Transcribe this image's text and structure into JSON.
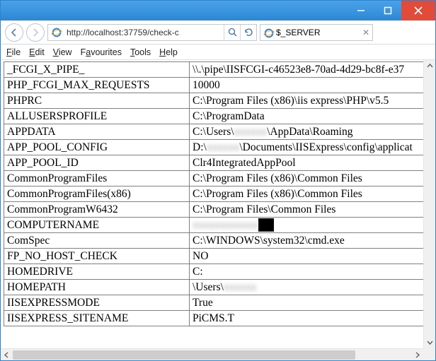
{
  "colors": {
    "titlebar_start": "#4aa3e8",
    "titlebar_end": "#2d87d4",
    "close": "#e04b3a",
    "border": "#2e84d2"
  },
  "url": "http://localhost:37759/check-c",
  "tab": {
    "title": "$_SERVER"
  },
  "menu": {
    "file": "File",
    "edit": "Edit",
    "view": "View",
    "favourites": "Favourites",
    "tools": "Tools",
    "help": "Help"
  },
  "rows": [
    {
      "key": "_FCGI_X_PIPE_",
      "value": "\\\\.\\pipe\\IISFCGI-c46523e8-70ad-4d29-bc8f-e37"
    },
    {
      "key": "PHP_FCGI_MAX_REQUESTS",
      "value": "10000"
    },
    {
      "key": "PHPRC",
      "value": "C:\\Program Files (x86)\\iis express\\PHP\\v5.5"
    },
    {
      "key": "ALLUSERSPROFILE",
      "value": "C:\\ProgramData"
    },
    {
      "key": "APPDATA",
      "value": "C:\\Users\\████\\AppData\\Roaming"
    },
    {
      "key": "APP_POOL_CONFIG",
      "value": "D:\\████\\Documents\\IISExpress\\config\\applicat"
    },
    {
      "key": "APP_POOL_ID",
      "value": "Clr4IntegratedAppPool"
    },
    {
      "key": "CommonProgramFiles",
      "value": "C:\\Program Files (x86)\\Common Files"
    },
    {
      "key": "CommonProgramFiles(x86)",
      "value": "C:\\Program Files (x86)\\Common Files"
    },
    {
      "key": "CommonProgramW6432",
      "value": "C:\\Program Files\\Common Files"
    },
    {
      "key": "COMPUTERNAME",
      "value": "██████████"
    },
    {
      "key": "ComSpec",
      "value": "C:\\WINDOWS\\system32\\cmd.exe"
    },
    {
      "key": "FP_NO_HOST_CHECK",
      "value": "NO"
    },
    {
      "key": "HOMEDRIVE",
      "value": "C:"
    },
    {
      "key": "HOMEPATH",
      "value": "\\Users\\████"
    },
    {
      "key": "IISEXPRESSMODE",
      "value": "True"
    },
    {
      "key": "IISEXPRESS_SITENAME",
      "value": "PiCMS.T"
    }
  ]
}
